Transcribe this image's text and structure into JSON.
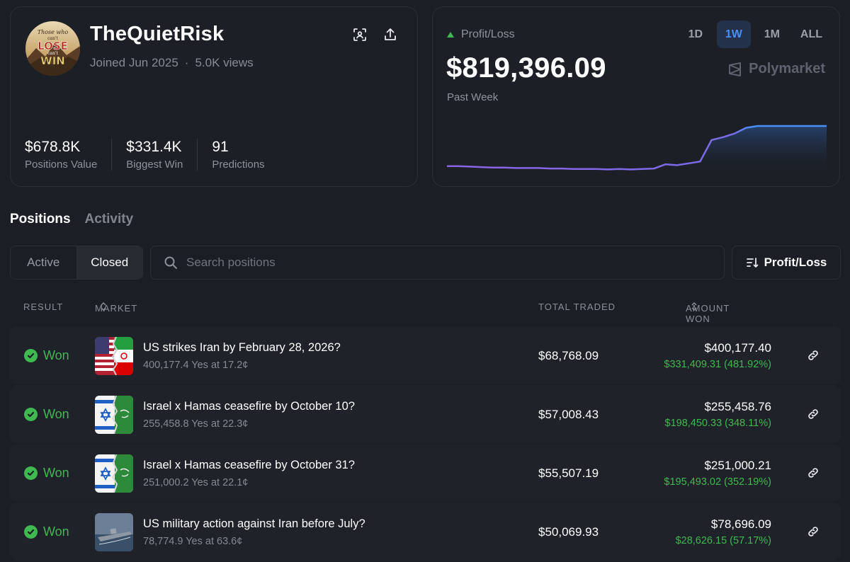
{
  "profile": {
    "username": "TheQuietRisk",
    "joined": "Joined Jun 2025",
    "separator": "·",
    "views": "5.0K views",
    "avatar_text": [
      "Those who",
      "can't",
      "LOSE",
      "can't",
      "WIN"
    ],
    "stats": [
      {
        "value": "$678.8K",
        "label": "Positions Value"
      },
      {
        "value": "$331.4K",
        "label": "Biggest Win"
      },
      {
        "value": "91",
        "label": "Predictions"
      }
    ]
  },
  "pnl": {
    "label": "Profit/Loss",
    "value": "$819,396.09",
    "period": "Past Week",
    "brand": "Polymarket",
    "ranges": [
      "1D",
      "1W",
      "1M",
      "ALL"
    ],
    "active_range": "1W",
    "colors": {
      "line_start": "#8a63e6",
      "line_end": "#4a8ff6"
    }
  },
  "chart_data": {
    "type": "line",
    "series": [
      {
        "values": [
          0.07,
          0.07,
          0.065,
          0.06,
          0.055,
          0.055,
          0.05,
          0.05,
          0.05,
          0.045,
          0.045,
          0.04,
          0.04,
          0.04,
          0.035,
          0.04,
          0.035,
          0.04,
          0.045,
          0.09,
          0.08,
          0.1,
          0.12,
          0.35,
          0.38,
          0.42,
          0.48,
          0.5,
          0.5,
          0.5,
          0.5,
          0.5,
          0.5,
          0.5
        ]
      }
    ]
  },
  "tabs": {
    "positions": "Positions",
    "activity": "Activity"
  },
  "filters": {
    "active": "Active",
    "closed": "Closed",
    "search_placeholder": "Search positions",
    "sort": "Profit/Loss"
  },
  "table": {
    "headers": {
      "result": "RESULT",
      "market": "MARKET",
      "total_traded": "TOTAL TRADED",
      "amount_won": "AMOUNT WON"
    },
    "rows": [
      {
        "result": "Won",
        "title": "US strikes Iran by February 28, 2026?",
        "subtitle": "400,177.4 Yes at 17.2¢",
        "traded": "$68,768.09",
        "amount": "$400,177.40",
        "gain": "$331,409.31 (481.92%)",
        "thumb": "us-iran"
      },
      {
        "result": "Won",
        "title": "Israel x Hamas ceasefire by October 10?",
        "subtitle": "255,458.8 Yes at 22.3¢",
        "traded": "$57,008.43",
        "amount": "$255,458.76",
        "gain": "$198,450.33 (348.11%)",
        "thumb": "israel-hamas"
      },
      {
        "result": "Won",
        "title": "Israel x Hamas ceasefire by October 31?",
        "subtitle": "251,000.2 Yes at 22.1¢",
        "traded": "$55,507.19",
        "amount": "$251,000.21",
        "gain": "$195,493.02 (352.19%)",
        "thumb": "israel-hamas"
      },
      {
        "result": "Won",
        "title": "US military action against Iran before July?",
        "subtitle": "78,774.9 Yes at 63.6¢",
        "traded": "$50,069.93",
        "amount": "$78,696.09",
        "gain": "$28,626.15 (57.17%)",
        "thumb": "warship"
      }
    ]
  }
}
